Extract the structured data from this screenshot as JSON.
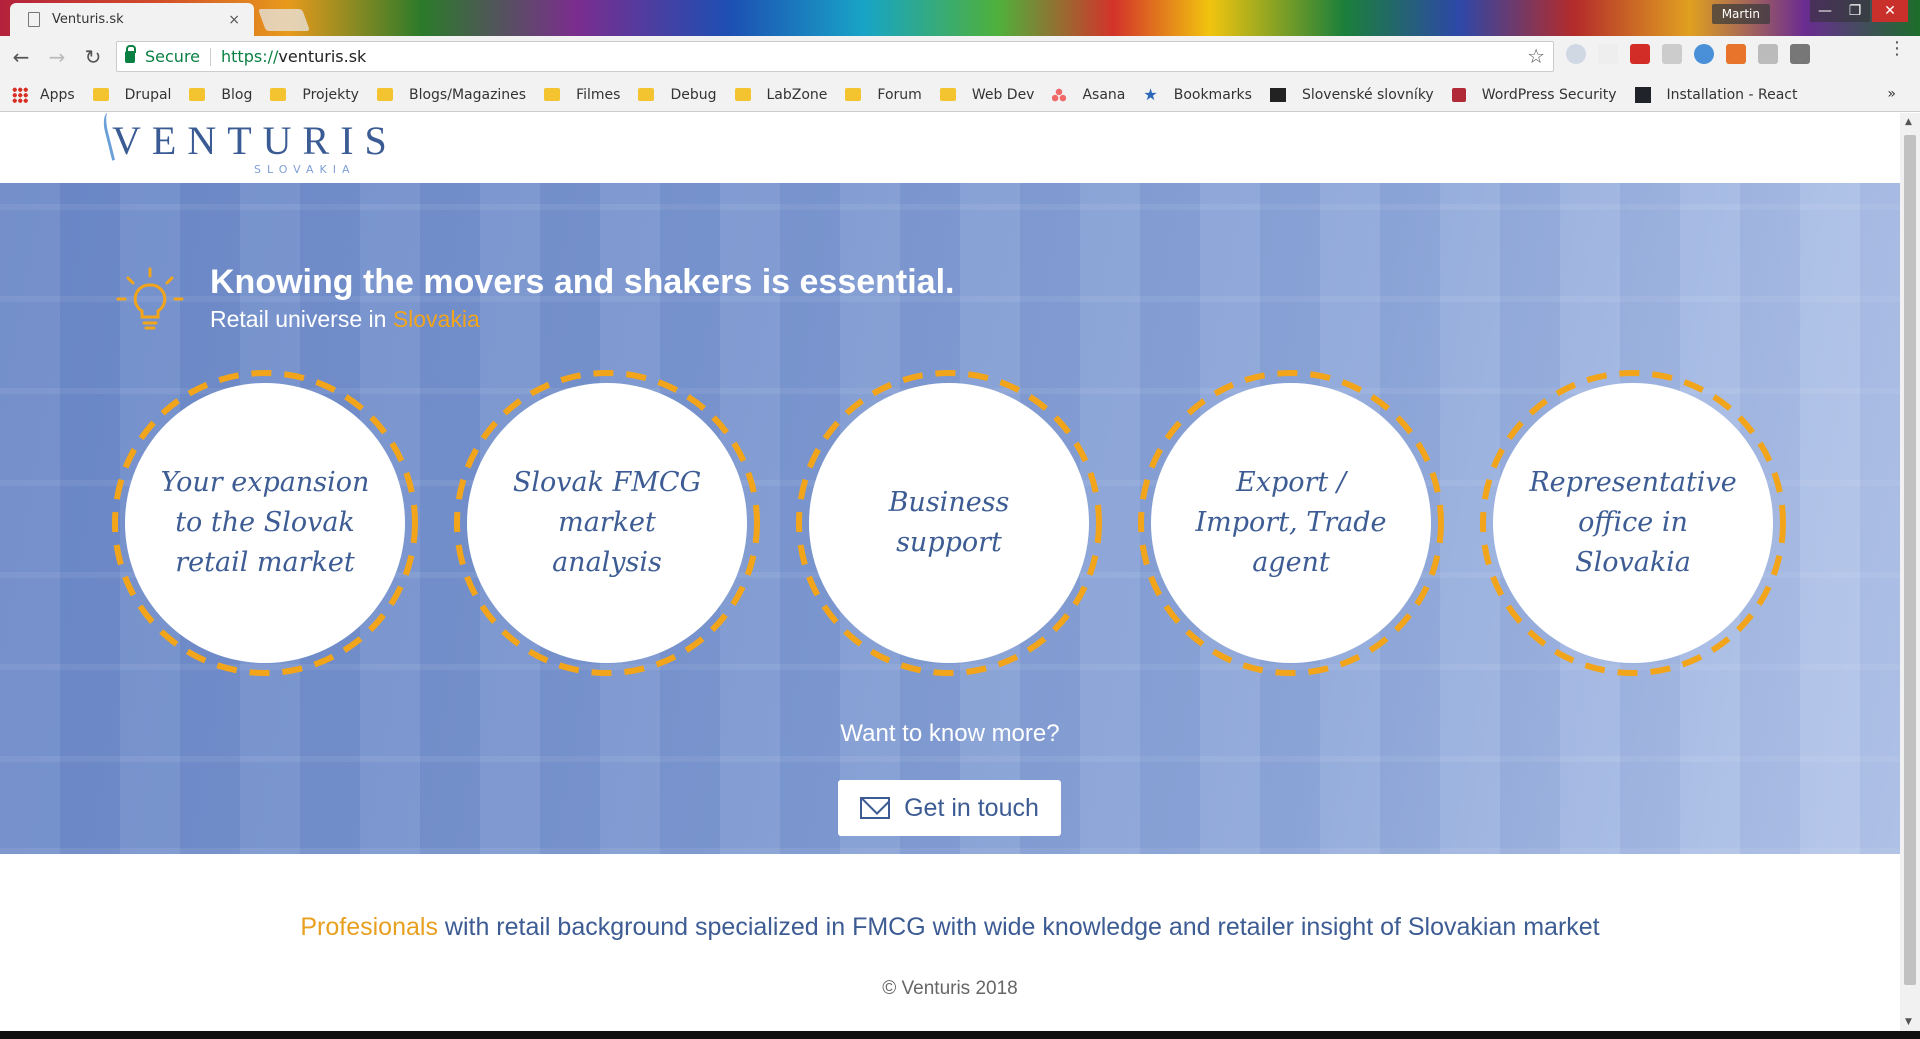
{
  "browser": {
    "tab_title": "Venturis.sk",
    "tab_close": "×",
    "user": "Martin",
    "win_min": "—",
    "win_max": "❐",
    "win_close": "✕",
    "secure_label": "Secure",
    "url_scheme": "https://",
    "url_host": "venturis.sk",
    "bookmarks": [
      "Apps",
      "Drupal",
      "Blog",
      "Projekty",
      "Blogs/Magazines",
      "Filmes",
      "Debug",
      "LabZone",
      "Forum",
      "Web Dev",
      "Asana",
      "Bookmarks",
      "Slovenské slovníky",
      "WordPress Security",
      "Installation - React"
    ],
    "bookmarks_more": "»"
  },
  "site": {
    "logo": "VENTURIS",
    "logo_sub": "SLOVAKIA",
    "headline": "Knowing the movers and shakers is essential.",
    "subline_prefix": "Retail universe in ",
    "subline_highlight": "Slovakia",
    "services": [
      "Your expansion to the Slovak retail market",
      "Slovak FMCG market analysis",
      "Business support",
      "Export / Import, Trade agent",
      "Representative office in Slovakia"
    ],
    "know_more": "Want to know more?",
    "cta_label": "Get in touch",
    "tagline_highlight": "Profesionals",
    "tagline_rest": " with retail background specialized in FMCG with wide knowledge and retailer insight of Slovakian market",
    "copyright": "© Venturis 2018"
  },
  "colors": {
    "brand_blue": "#3d5c94",
    "accent_orange": "#f2a51a",
    "hero_blue": "#7b97d0"
  }
}
